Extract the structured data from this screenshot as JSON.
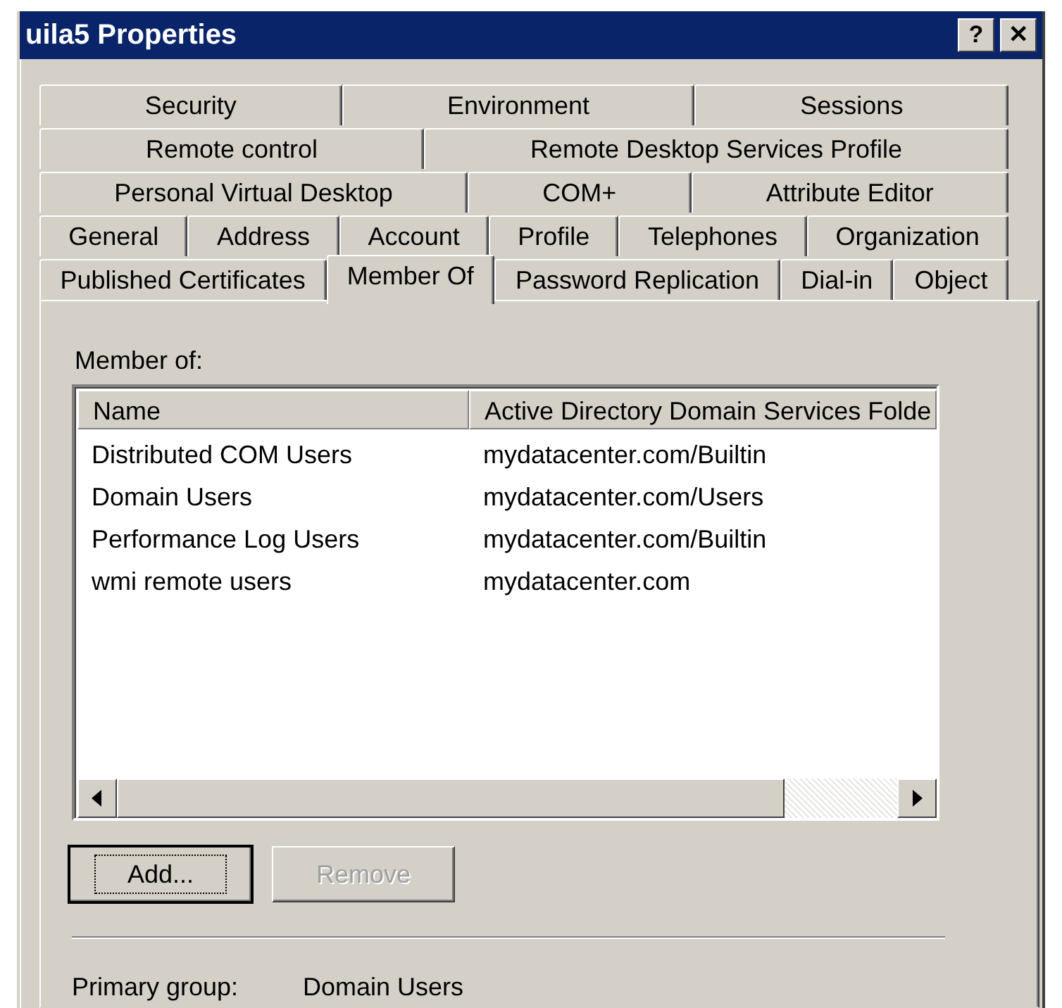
{
  "window": {
    "title": "uila5 Properties",
    "buttons": [
      {
        "label": "?"
      },
      {
        "label": "✕"
      }
    ]
  },
  "tab_rows": [
    [
      {
        "label": "Security",
        "selected": false
      },
      {
        "label": "Environment",
        "selected": false
      },
      {
        "label": "Sessions",
        "selected": false
      }
    ],
    [
      {
        "label": "Remote control",
        "selected": false
      },
      {
        "label": "Remote Desktop Services Profile",
        "selected": false
      }
    ],
    [
      {
        "label": "Personal Virtual Desktop",
        "selected": false
      },
      {
        "label": "COM+",
        "selected": false
      },
      {
        "label": "Attribute Editor",
        "selected": false
      }
    ],
    [
      {
        "label": "General",
        "selected": false
      },
      {
        "label": "Address",
        "selected": false
      },
      {
        "label": "Account",
        "selected": false
      },
      {
        "label": "Profile",
        "selected": false
      },
      {
        "label": "Telephones",
        "selected": false
      },
      {
        "label": "Organization",
        "selected": false
      }
    ],
    [
      {
        "label": "Published Certificates",
        "selected": false
      },
      {
        "label": "Member Of",
        "selected": true
      },
      {
        "label": "Password Replication",
        "selected": false
      },
      {
        "label": "Dial-in",
        "selected": false
      },
      {
        "label": "Object",
        "selected": false
      }
    ]
  ],
  "member_of": {
    "label": "Member of:",
    "columns": [
      "Name",
      "Active Directory Domain Services Folde"
    ],
    "rows": [
      [
        "Distributed COM Users",
        "mydatacenter.com/Builtin"
      ],
      [
        "Domain Users",
        "mydatacenter.com/Users"
      ],
      [
        "Performance Log Users",
        "mydatacenter.com/Builtin"
      ],
      [
        "wmi remote users",
        "mydatacenter.com"
      ]
    ]
  },
  "buttons": [
    {
      "label": "Add...",
      "disabled": false,
      "focused": true
    },
    {
      "label": "Remove",
      "disabled": true,
      "focused": false
    }
  ],
  "primary_group": {
    "label": "Primary group:",
    "value": "Domain Users"
  }
}
